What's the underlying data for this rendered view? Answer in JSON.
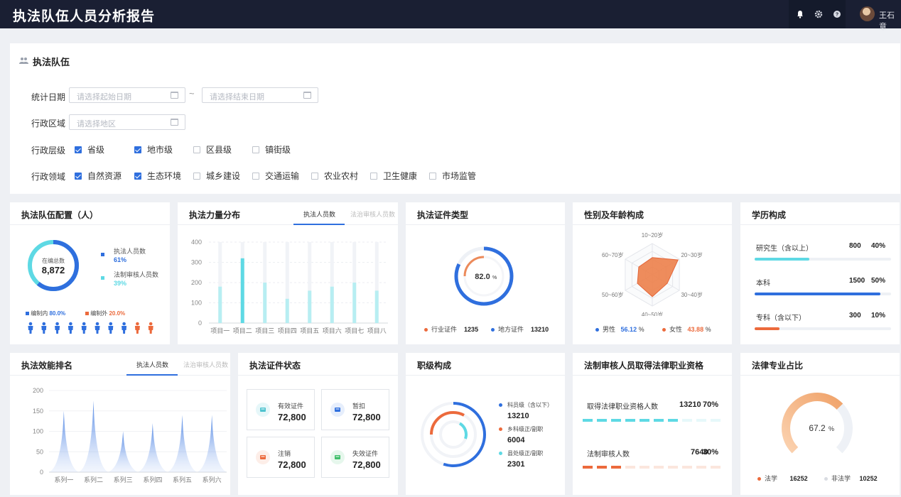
{
  "app": {
    "title": "执法队伍人员分析报告",
    "user": "王石意"
  },
  "colors": {
    "primary": "#2f6fde",
    "cyan": "#5ed9e4",
    "orange": "#ec6a3c",
    "dark": "#1a1f33"
  },
  "filter": {
    "title": "执法队伍",
    "date_label": "统计日期",
    "start_placeholder": "请选择起始日期",
    "end_placeholder": "请选择结束日期",
    "tilde": "~",
    "region_label": "行政区域",
    "region_placeholder": "请选择地区",
    "level_label": "行政层级",
    "levels": [
      {
        "label": "省级",
        "checked": true
      },
      {
        "label": "地市级",
        "checked": true
      },
      {
        "label": "区县级",
        "checked": false
      },
      {
        "label": "镇街级",
        "checked": false
      }
    ],
    "domain_label": "行政领域",
    "domains": [
      {
        "label": "自然资源",
        "checked": true
      },
      {
        "label": "生态环境",
        "checked": true
      },
      {
        "label": "城乡建设",
        "checked": false
      },
      {
        "label": "交通运输",
        "checked": false
      },
      {
        "label": "农业农村",
        "checked": false
      },
      {
        "label": "卫生健康",
        "checked": false
      },
      {
        "label": "市场监管",
        "checked": false
      }
    ]
  },
  "config": {
    "title": "执法队伍配置（人）",
    "center_label": "在编总数",
    "center_value": "8,872",
    "legend1_label": "执法人员数",
    "legend1_value": "61%",
    "legend2_label": "法制审核人员数",
    "legend2_value": "39%",
    "in_label": "编制内",
    "in_value": "80.0%",
    "out_label": "编制外",
    "out_value": "20.0%",
    "people_in_fraction": 0.8
  },
  "force": {
    "title": "执法力量分布",
    "tab1": "执法人员数",
    "tab2": "法治审核人员数",
    "chart_data": {
      "type": "bar",
      "categories": [
        "项目一",
        "项目二",
        "项目三",
        "项目四",
        "项目五",
        "项目六",
        "项目七",
        "项目八"
      ],
      "series": [
        {
          "values": [
            180,
            320,
            200,
            120,
            160,
            180,
            200,
            160
          ]
        }
      ],
      "ylim": [
        0,
        400
      ],
      "yticks": [
        "0",
        "100",
        "200",
        "300",
        "400"
      ]
    }
  },
  "cert_type": {
    "title": "执法证件类型",
    "percent": "82.0",
    "percent_unit": "%",
    "legend1_label": "行业证件",
    "legend1_value": "1235",
    "legend2_label": "地方证件",
    "legend2_value": "13210"
  },
  "gender_age": {
    "title": "性别及年龄构成",
    "axes": [
      "10~20岁",
      "20~30岁",
      "30~40岁",
      "40~50岁",
      "50~60岁",
      "60~70岁"
    ],
    "values": [
      0.55,
      0.95,
      0.55,
      0.7,
      0.55,
      0.5
    ],
    "male_label": "男性",
    "male_value": "56.12",
    "female_label": "女性",
    "female_value": "43.88",
    "pct": "%"
  },
  "education": {
    "title": "学历构成",
    "rows": [
      {
        "label": "研究生（含以上）",
        "count": "800",
        "pct": "40%",
        "fraction": 0.4,
        "color": "#5ed9e4"
      },
      {
        "label": "本科",
        "count": "1500",
        "pct": "50%",
        "fraction": 0.92,
        "color": "#2f6fde"
      },
      {
        "label": "专科（含以下）",
        "count": "300",
        "pct": "10%",
        "fraction": 0.18,
        "color": "#ec6a3c"
      }
    ]
  },
  "efficiency": {
    "title": "执法效能排名",
    "tab1": "执法人员数",
    "tab2": "法治审核人员数",
    "chart_data": {
      "type": "area",
      "categories": [
        "系列一",
        "系列二",
        "系列三",
        "系列四",
        "系列五",
        "系列六"
      ],
      "values": [
        150,
        175,
        100,
        120,
        140,
        140
      ],
      "ylim": [
        0,
        200
      ],
      "yticks": [
        "0",
        "50",
        "100",
        "150",
        "200"
      ]
    }
  },
  "cert_status": {
    "title": "执法证件状态",
    "items": [
      {
        "label": "有效证件",
        "value": "72,800",
        "color": "#4fc3cf",
        "bg": "#e6f7f9"
      },
      {
        "label": "暂扣",
        "value": "72,800",
        "color": "#2f6fde",
        "bg": "#e6eefc"
      },
      {
        "label": "注销",
        "value": "72,800",
        "color": "#ec6a3c",
        "bg": "#fdeee8"
      },
      {
        "label": "失效证件",
        "value": "72,800",
        "color": "#3fbf6a",
        "bg": "#e6f7ec"
      }
    ]
  },
  "rank": {
    "title": "职级构成",
    "items": [
      {
        "label": "科员级（含以下）",
        "value": "13210",
        "color": "#2f6fde"
      },
      {
        "label": "乡科级正/副职",
        "value": "6004",
        "color": "#ec6a3c"
      },
      {
        "label": "县处级正/副职",
        "value": "2301",
        "color": "#5ed9e4"
      }
    ],
    "fractions": [
      0.55,
      0.33,
      0.22
    ]
  },
  "qualification": {
    "title": "法制审核人员取得法律职业资格",
    "row1_label": "取得法律职业资格人数",
    "row1_value": "13210",
    "row1_pct": "70%",
    "row1_fraction": 0.7,
    "row2_label": "法制审核人数",
    "row2_value": "7640",
    "row2_pct": "30%",
    "row2_fraction": 0.3
  },
  "law_major": {
    "title": "法律专业占比",
    "percent": "67.2",
    "percent_unit": "%",
    "fraction": 0.672,
    "legend1_label": "法学",
    "legend1_value": "16252",
    "legend2_label": "非法学",
    "legend2_value": "10252"
  }
}
